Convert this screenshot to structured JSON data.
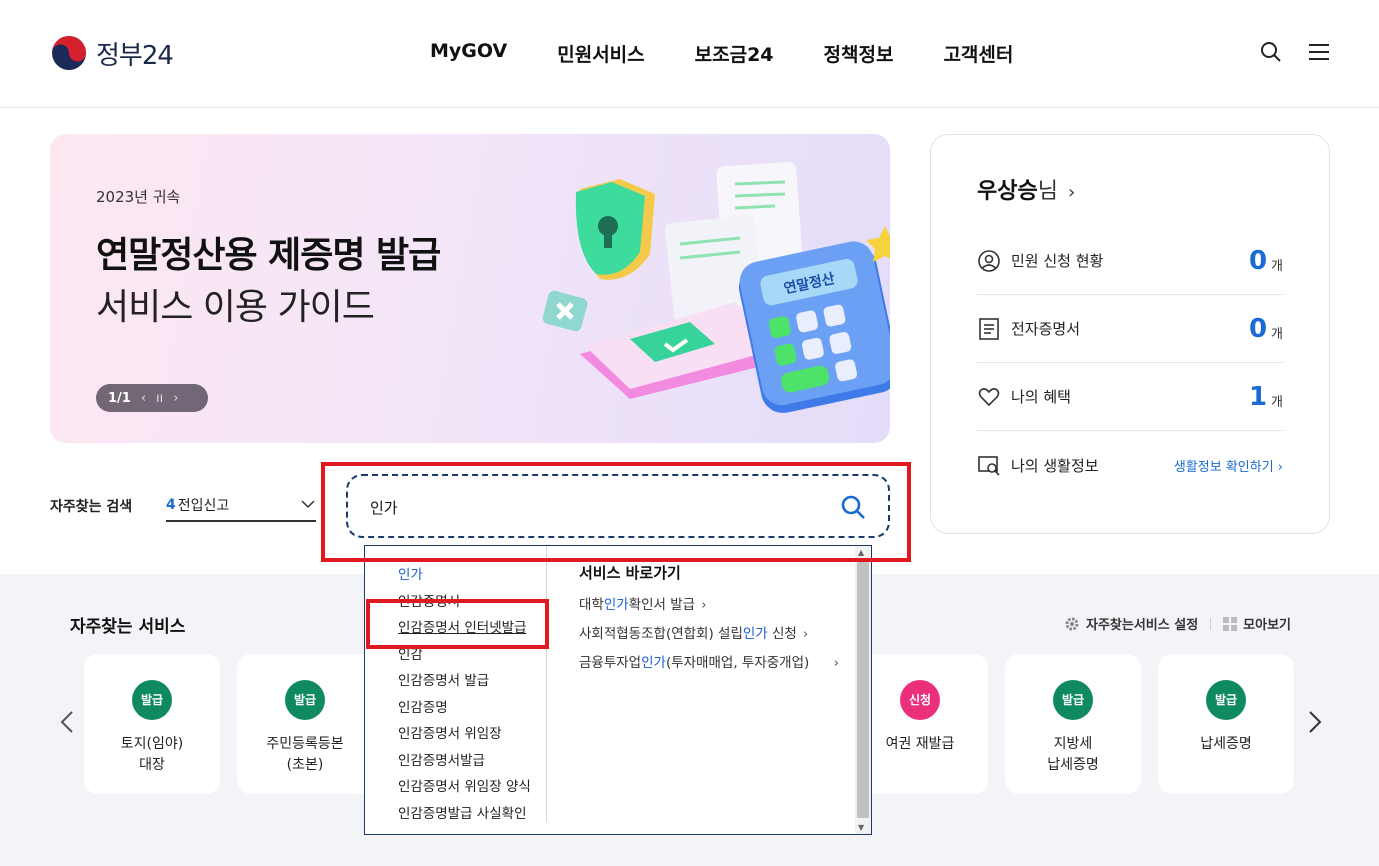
{
  "header": {
    "logo_text": "정부24",
    "nav": [
      "MyGOV",
      "민원서비스",
      "보조금24",
      "정책정보",
      "고객센터"
    ]
  },
  "banner": {
    "sub": "2023년 귀속",
    "title": "연말정산용 제증명 발급",
    "title2": "서비스 이용 가이드",
    "page": "1/1",
    "art_label": "연말정산"
  },
  "frequent_search": {
    "label": "자주찾는 검색",
    "rank": "4",
    "keyword": "전입신고"
  },
  "search": {
    "value": "인가"
  },
  "autocomplete": {
    "items": [
      "인가",
      "인감증명서",
      "인감증명서 인터넷발급",
      "인감",
      "인감증명서 발급",
      "인감증명",
      "인감증명서 위임장",
      "인감증명서발급",
      "인감증명서 위임장 양식",
      "인감증명발급 사실확인"
    ],
    "services_title": "서비스 바로가기",
    "services": [
      {
        "pre": "대학",
        "kw": "인가",
        "post": "확인서 발급"
      },
      {
        "pre": "사회적협동조합(연합회) 설립",
        "kw": "인가",
        "post": " 신청"
      },
      {
        "pre": "금융투자업",
        "kw": "인가",
        "post": "(투자매매업, 투자중개업)"
      }
    ]
  },
  "user": {
    "name": "우상승",
    "suffix": "님",
    "rows": [
      {
        "label": "민원 신청 현황",
        "count": "0",
        "unit": "개"
      },
      {
        "label": "전자증명서",
        "count": "0",
        "unit": "개"
      },
      {
        "label": "나의 혜택",
        "count": "1",
        "unit": "개"
      }
    ],
    "life_label": "나의 생활정보",
    "life_link": "생활정보 확인하기"
  },
  "services": {
    "title": "자주찾는 서비스",
    "settings": "자주찾는서비스 설정",
    "viewall": "모아보기",
    "cards": [
      {
        "badge": "발급",
        "label": "토지(임야)\n대장",
        "color": "#0f8a5f"
      },
      {
        "badge": "발급",
        "label": "주민등록등본\n(초본)",
        "color": "#0f8a5f"
      },
      {
        "badge": "신청",
        "label": "여권 재발급",
        "color": "#ec2f7b"
      },
      {
        "badge": "발급",
        "label": "지방세\n납세증명",
        "color": "#0f8a5f"
      },
      {
        "badge": "발급",
        "label": "납세증명",
        "color": "#0f8a5f"
      }
    ]
  }
}
